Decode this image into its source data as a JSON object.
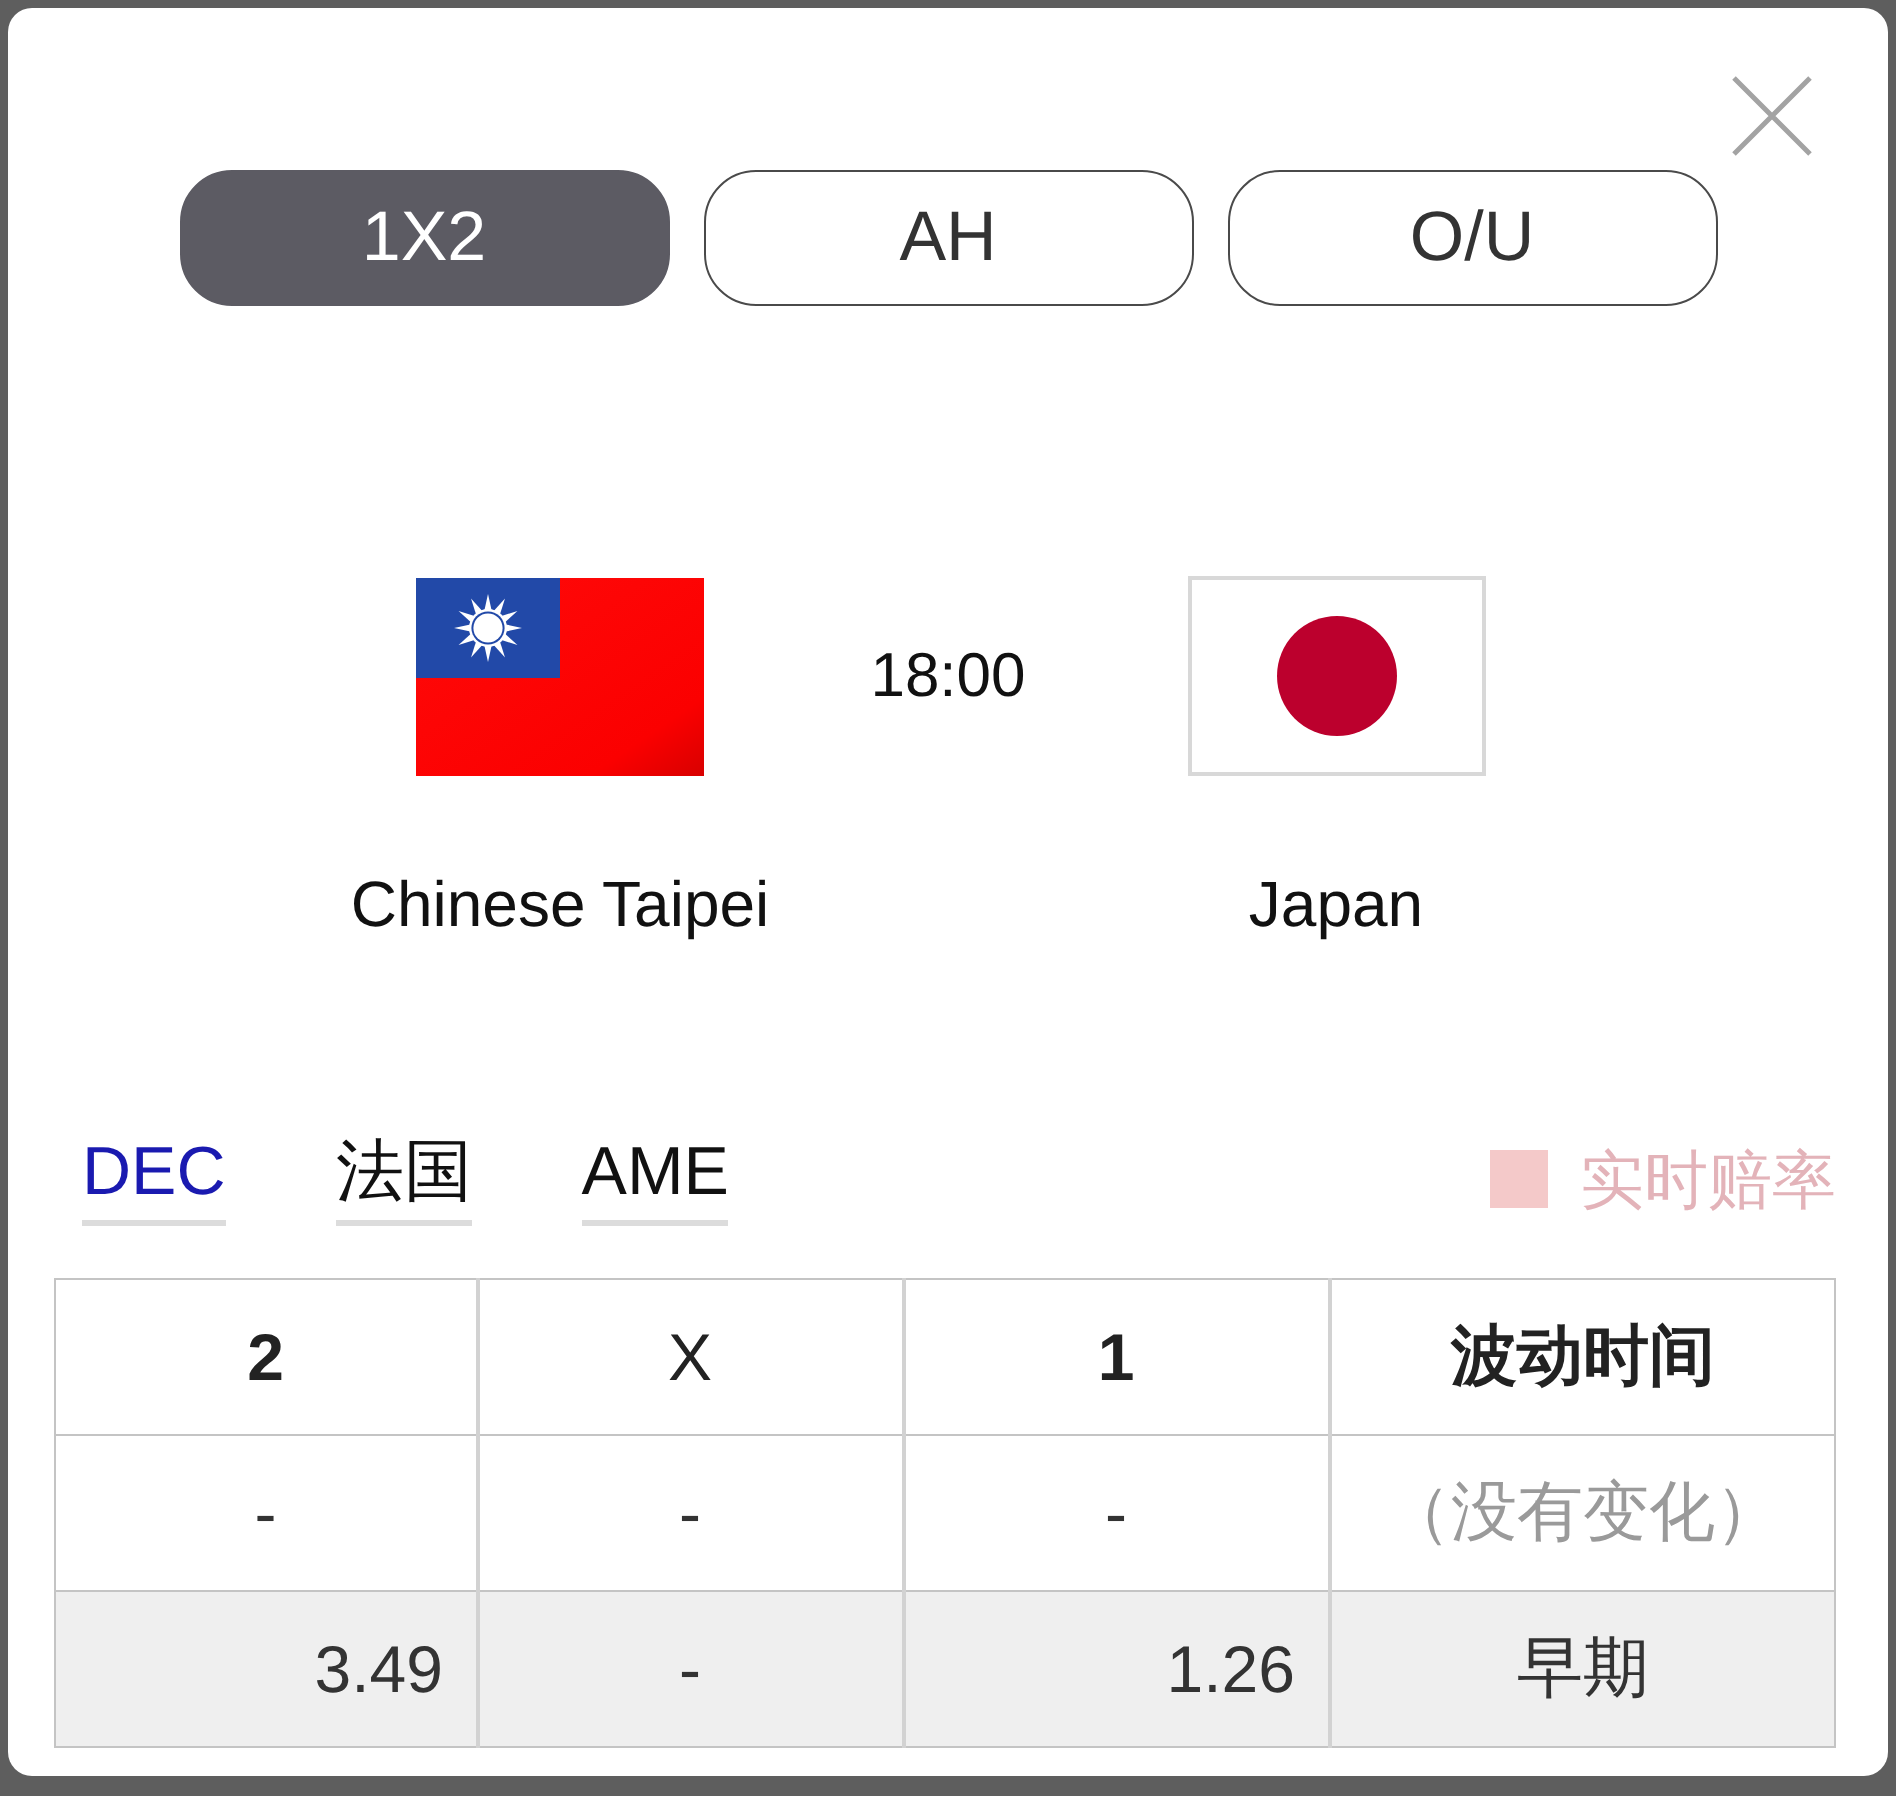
{
  "tabs": [
    {
      "label": "1X2",
      "selected": true
    },
    {
      "label": "AH",
      "selected": false
    },
    {
      "label": "O/U",
      "selected": false
    }
  ],
  "match": {
    "teams": [
      {
        "name": "Chinese Taipei"
      },
      {
        "name": "Japan"
      }
    ],
    "time": "18:00"
  },
  "odds_formats": [
    {
      "label": "DEC",
      "selected": true
    },
    {
      "label": "法国",
      "selected": false
    },
    {
      "label": "AME",
      "selected": false
    }
  ],
  "legend": {
    "label": "实时赔率"
  },
  "table": {
    "columns": [
      {
        "label": "2",
        "bold": true
      },
      {
        "label": "X",
        "bold": false
      },
      {
        "label": "1",
        "bold": true
      },
      {
        "label": "波动时间",
        "bold": true
      }
    ],
    "rows": [
      {
        "highlighted": false,
        "cells": [
          {
            "text": "-",
            "kind": "empty"
          },
          {
            "text": "-",
            "kind": "empty"
          },
          {
            "text": "-",
            "kind": "empty"
          },
          {
            "text": "（没有变化）",
            "kind": "note"
          }
        ]
      },
      {
        "highlighted": true,
        "cells": [
          {
            "text": "3.49",
            "kind": "odds"
          },
          {
            "text": "-",
            "kind": "empty"
          },
          {
            "text": "1.26",
            "kind": "odds"
          },
          {
            "text": "早期",
            "kind": "time"
          }
        ]
      }
    ]
  }
}
